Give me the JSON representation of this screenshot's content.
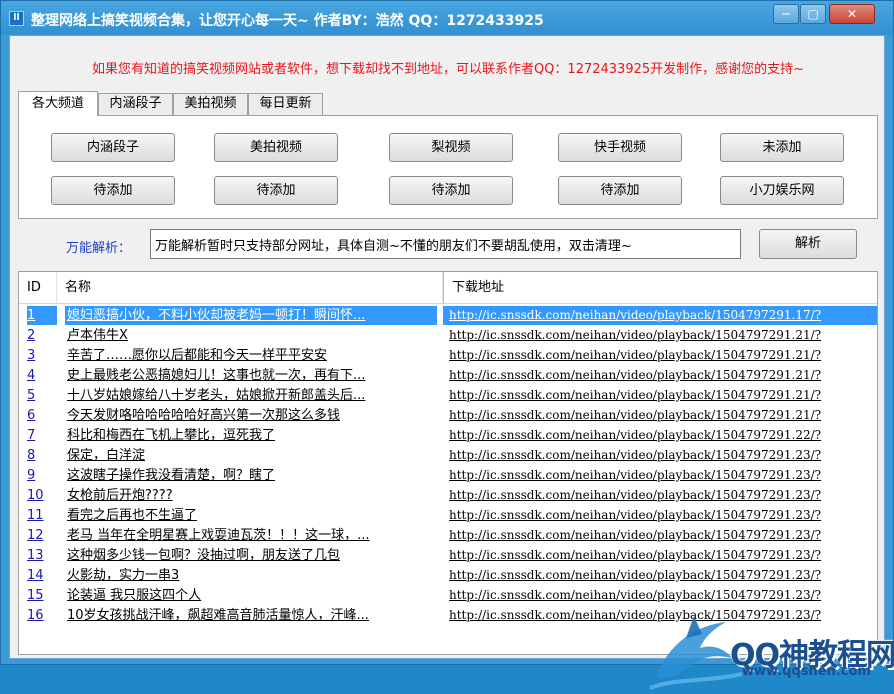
{
  "window": {
    "title": "整理网络上搞笑视频合集，让您开心每一天~  作者BY：浩然 QQ：1272433925",
    "icon_text": "ll",
    "minimize_glyph": "─",
    "maximize_glyph": "▢",
    "close_glyph": "✕"
  },
  "notice": "如果您有知道的搞笑视频网站或者软件，想下载却找不到地址，可以联系作者QQ：1272433925开发制作，感谢您的支持~",
  "tabs": [
    "各大频道",
    "内涵段子",
    "美拍视频",
    "每日更新"
  ],
  "channels": [
    "内涵段子",
    "美拍视频",
    "梨视频",
    "快手视频",
    "未添加",
    "待添加",
    "待添加",
    "待添加",
    "待添加",
    "小刀娱乐网"
  ],
  "parse": {
    "label": "万能解析：",
    "value": "万能解析暂时只支持部分网址，具体自测~不懂的朋友们不要胡乱使用，双击清理~",
    "button": "解析"
  },
  "table": {
    "columns": [
      "ID",
      "名称",
      "下载地址"
    ],
    "rows": [
      {
        "id": "1",
        "name": "媳妇恶搞小伙，不料小伙却被老妈一顿打！瞬间怀...",
        "url": "http://ic.snssdk.com/neihan/video/playback/1504797291.17/?"
      },
      {
        "id": "2",
        "name": "卢本伟牛X",
        "url": "http://ic.snssdk.com/neihan/video/playback/1504797291.21/?"
      },
      {
        "id": "3",
        "name": "辛苦了……愿你以后都能和今天一样平平安安",
        "url": "http://ic.snssdk.com/neihan/video/playback/1504797291.21/?"
      },
      {
        "id": "4",
        "name": "史上最贱老公恶搞媳妇儿！这事也就一次，再有下...",
        "url": "http://ic.snssdk.com/neihan/video/playback/1504797291.21/?"
      },
      {
        "id": "5",
        "name": "十八岁姑娘嫁给八十岁老头，姑娘掀开新郎盖头后...",
        "url": "http://ic.snssdk.com/neihan/video/playback/1504797291.21/?"
      },
      {
        "id": "6",
        "name": "今天发财咯哈哈哈哈哈好高兴第一次那这么多钱",
        "url": "http://ic.snssdk.com/neihan/video/playback/1504797291.21/?"
      },
      {
        "id": "7",
        "name": "科比和梅西在飞机上攀比，逗死我了",
        "url": "http://ic.snssdk.com/neihan/video/playback/1504797291.22/?"
      },
      {
        "id": "8",
        "name": "保定，白洋淀",
        "url": "http://ic.snssdk.com/neihan/video/playback/1504797291.23/?"
      },
      {
        "id": "9",
        "name": "这波瞎子操作我没看清楚，啊？瞎了",
        "url": "http://ic.snssdk.com/neihan/video/playback/1504797291.23/?"
      },
      {
        "id": "10",
        "name": "女枪前后开炮????",
        "url": "http://ic.snssdk.com/neihan/video/playback/1504797291.23/?"
      },
      {
        "id": "11",
        "name": "看完之后再也不生逼了",
        "url": "http://ic.snssdk.com/neihan/video/playback/1504797291.23/?"
      },
      {
        "id": "12",
        "name": "老马 当年在全明星赛上戏耍迪瓦茨！！！这一球，...",
        "url": "http://ic.snssdk.com/neihan/video/playback/1504797291.23/?"
      },
      {
        "id": "13",
        "name": "这种烟多少钱一包啊？没抽过啊，朋友送了几包",
        "url": "http://ic.snssdk.com/neihan/video/playback/1504797291.23/?"
      },
      {
        "id": "14",
        "name": "火影劫，实力一串3",
        "url": "http://ic.snssdk.com/neihan/video/playback/1504797291.23/?"
      },
      {
        "id": "15",
        "name": "论装逼 我只服这四个人",
        "url": "http://ic.snssdk.com/neihan/video/playback/1504797291.23/?"
      },
      {
        "id": "16",
        "name": "10岁女孩挑战汗峰，飙超难高音肺活量惊人，汗峰...",
        "url": "http://ic.snssdk.com/neihan/video/playback/1504797291.23/?"
      }
    ]
  },
  "watermark": {
    "text": "QQ神教程网",
    "url": "www.qqshen.com"
  },
  "colors": {
    "notice": "#e8161b",
    "parse_label": "#1b3fc7",
    "selection": "#3399ff",
    "title_bar": "#3d9ad6"
  }
}
